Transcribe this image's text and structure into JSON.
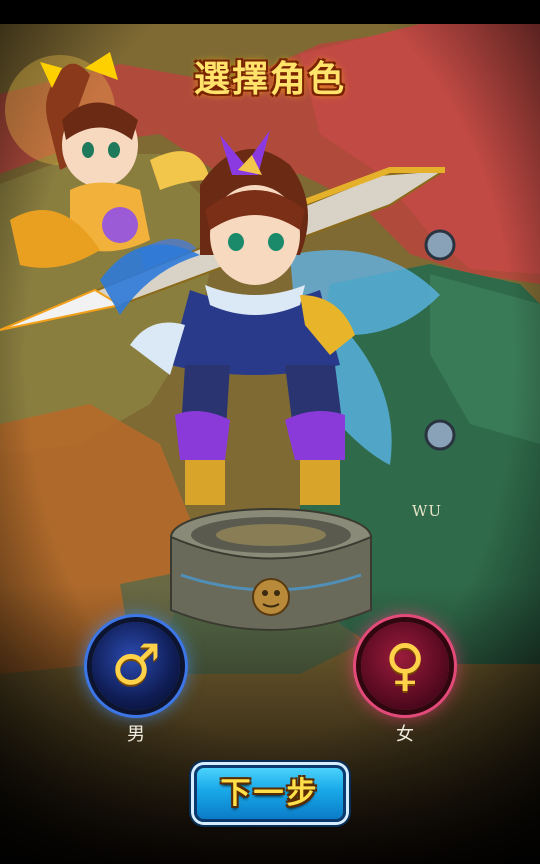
{
  "screen": {
    "title": "選擇角色",
    "region_label": "WU",
    "genders": [
      {
        "label": "男",
        "symbol": "♂",
        "color": "#ffd24a",
        "ring": "#3d76e6"
      },
      {
        "label": "女",
        "symbol": "♀",
        "color": "#ffd24a",
        "ring": "#e24a7a"
      }
    ],
    "next_button": {
      "label": "下一步"
    }
  },
  "colors": {
    "map_red": "#b9453e",
    "map_green": "#2f6b4a",
    "map_orange": "#b56a2a",
    "map_olive": "#8a7a3a",
    "title_gold": "#ffe36a",
    "button_blue": "#18a8e8"
  }
}
